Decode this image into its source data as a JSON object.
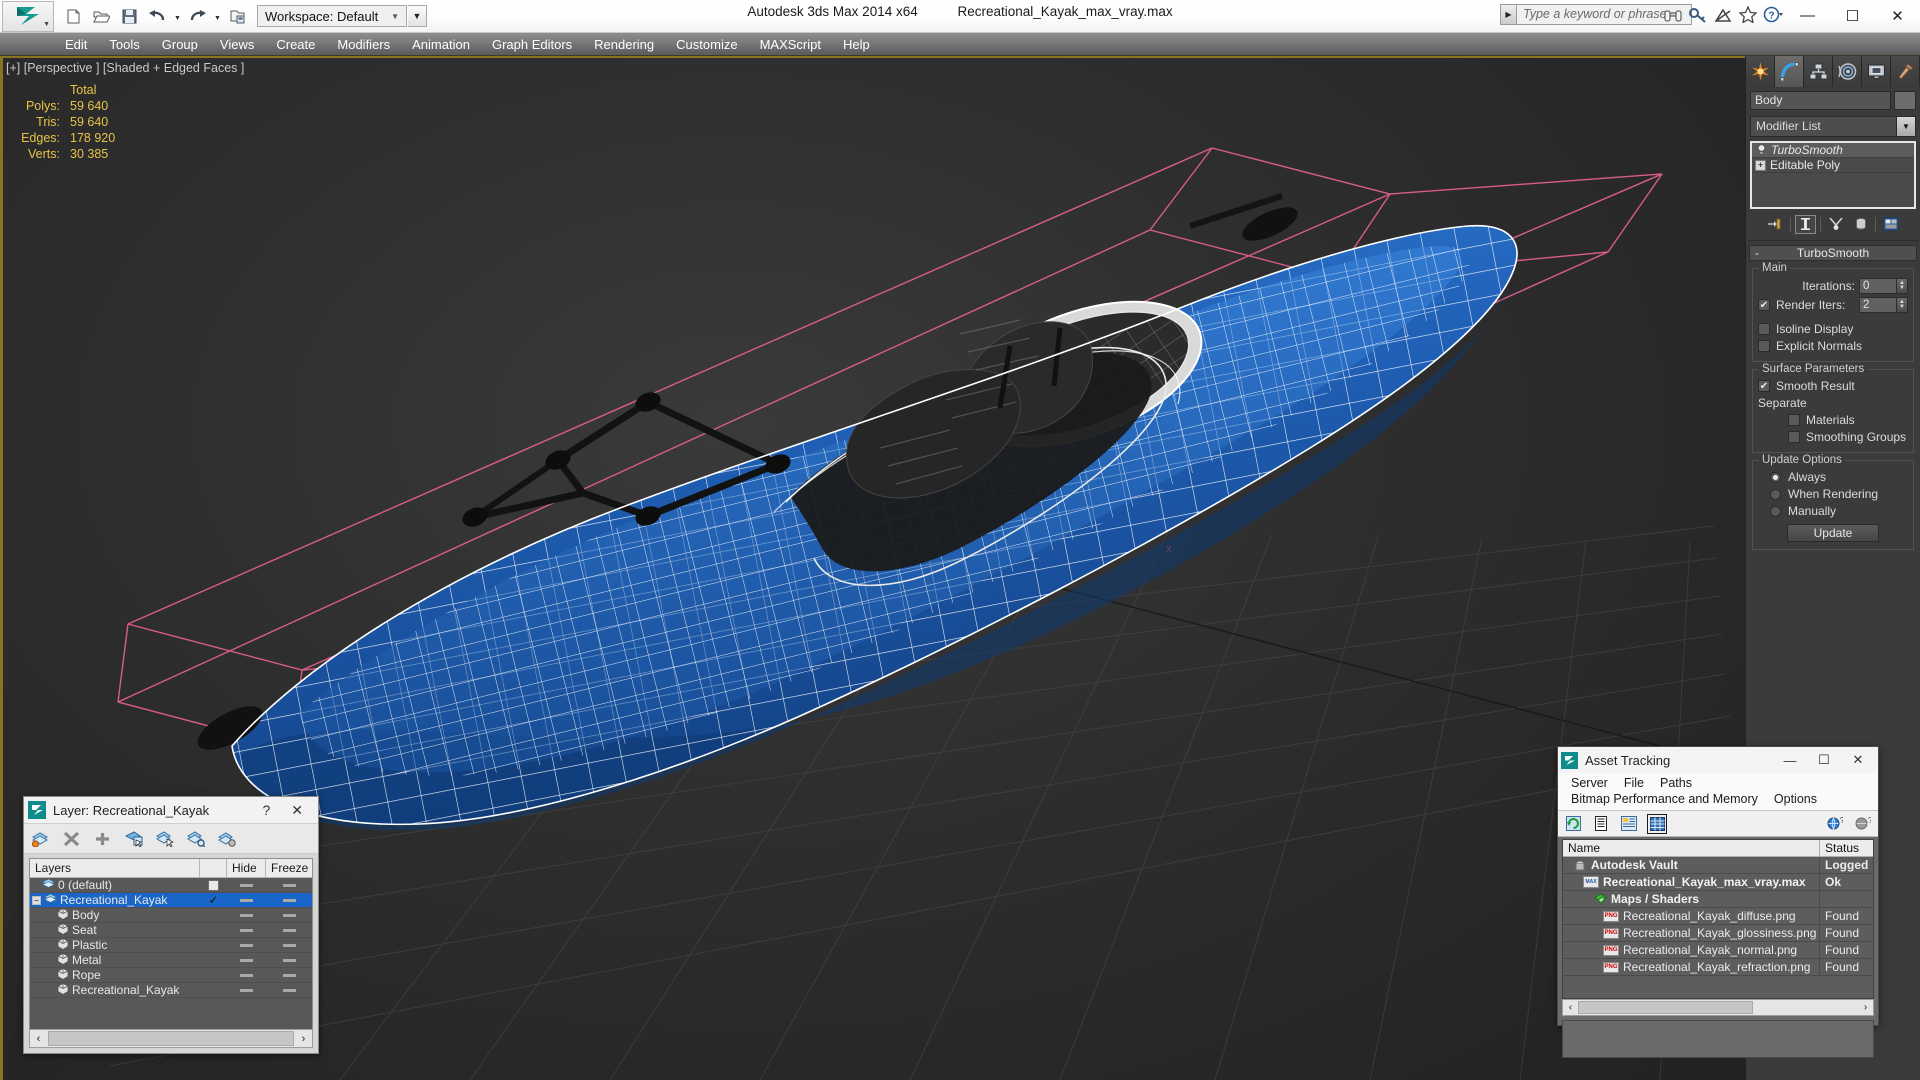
{
  "titlebar": {
    "app_logo_icon": "3dsmax-logo-icon",
    "quick_access": [
      {
        "name": "new-file-button",
        "icon": "new-file-icon"
      },
      {
        "name": "open-file-button",
        "icon": "open-folder-icon"
      },
      {
        "name": "save-file-button",
        "icon": "save-disk-icon"
      },
      {
        "name": "undo-button",
        "icon": "undo-arrow-icon"
      },
      {
        "name": "redo-button",
        "icon": "redo-arrow-icon"
      },
      {
        "name": "set-project-folder-button",
        "icon": "project-folder-icon"
      }
    ],
    "workspace_label": "Workspace: Default",
    "app_title": "Autodesk 3ds Max  2014 x64",
    "file_name": "Recreational_Kayak_max_vray.max",
    "search_placeholder": "Type a keyword or phrase",
    "infocenter_icons": [
      "binoculars-icon",
      "key-icon",
      "satellite-dish-icon",
      "star-favorites-icon",
      "help-question-icon"
    ],
    "window_controls": {
      "minimize": "—",
      "maximize": "☐",
      "close": "✕"
    }
  },
  "menubar": {
    "items": [
      "Edit",
      "Tools",
      "Group",
      "Views",
      "Create",
      "Modifiers",
      "Animation",
      "Graph Editors",
      "Rendering",
      "Customize",
      "MAXScript",
      "Help"
    ]
  },
  "viewport": {
    "label": "[+] [Perspective ] [Shaded + Edged Faces ]",
    "stats_header": "Total",
    "stats": [
      {
        "label": "Polys:",
        "value": "59 640"
      },
      {
        "label": "Tris:",
        "value": "59 640"
      },
      {
        "label": "Edges:",
        "value": "178 920"
      },
      {
        "label": "Verts:",
        "value": "30 385"
      }
    ],
    "model_colors": {
      "body": "#1f5fb5",
      "wire": "#ffffff",
      "accessory": "#1a1a1a",
      "gizmo_pink": "#e25f92",
      "grid": "#4a4a4a"
    }
  },
  "command_panel": {
    "tabs": [
      {
        "name": "create-tab",
        "icon": "star-burst-icon",
        "active": false
      },
      {
        "name": "modify-tab",
        "icon": "blue-arc-icon",
        "active": true
      },
      {
        "name": "hierarchy-tab",
        "icon": "hierarchy-tree-icon",
        "active": false
      },
      {
        "name": "motion-tab",
        "icon": "motion-wheel-icon",
        "active": false
      },
      {
        "name": "display-tab",
        "icon": "monitor-display-icon",
        "active": false
      },
      {
        "name": "utilities-tab",
        "icon": "hammer-icon",
        "active": false
      }
    ],
    "object_name": "Body",
    "modifier_list_label": "Modifier List",
    "stack": [
      {
        "label": "TurboSmooth",
        "selected": true,
        "icon": "lightbulb-icon"
      },
      {
        "label": "Editable Poly",
        "selected": false,
        "icon": "plus-box-icon"
      }
    ],
    "stack_tools": [
      "pin-stack-icon",
      "show-end-result-icon",
      "make-unique-icon",
      "remove-modifier-icon",
      "configure-sets-icon"
    ],
    "rollout": {
      "title": "TurboSmooth",
      "collapse_glyph": "-",
      "main_group": "Main",
      "iterations_label": "Iterations:",
      "iterations_value": "0",
      "render_iters_label": "Render Iters:",
      "render_iters_value": "2",
      "render_iters_checked": true,
      "isoline_display_label": "Isoline Display",
      "isoline_display_checked": false,
      "explicit_normals_label": "Explicit Normals",
      "explicit_normals_checked": false,
      "surface_group": "Surface Parameters",
      "smooth_result_label": "Smooth Result",
      "smooth_result_checked": true,
      "separate_label": "Separate",
      "materials_label": "Materials",
      "materials_checked": false,
      "smoothing_groups_label": "Smoothing Groups",
      "smoothing_groups_checked": false,
      "update_group": "Update Options",
      "update_options": [
        {
          "label": "Always",
          "selected": true
        },
        {
          "label": "When Rendering",
          "selected": false
        },
        {
          "label": "Manually",
          "selected": false
        }
      ],
      "update_button": "Update"
    }
  },
  "layer_dialog": {
    "title": "Layer: Recreational_Kayak",
    "help_glyph": "?",
    "close_glyph": "✕",
    "toolbar_icons": [
      "create-new-layer-icon",
      "delete-layer-icon",
      "add-layer-icon",
      "select-objects-in-layer-icon",
      "select-highlighted-layer-icon",
      "highlight-selected-objects-icon",
      "layer-properties-icon"
    ],
    "columns": [
      "Layers",
      "",
      "Hide",
      "Freeze"
    ],
    "rows": [
      {
        "name": "0 (default)",
        "indent": 0,
        "icon": "layer-stack-icon",
        "selected": false,
        "expander": false,
        "current": "checkbox-empty",
        "hide": "dash",
        "freeze": "dash"
      },
      {
        "name": "Recreational_Kayak",
        "indent": 0,
        "icon": "layer-stack-icon",
        "selected": true,
        "expander": true,
        "current": "check",
        "hide": "dash",
        "freeze": "dash"
      },
      {
        "name": "Body",
        "indent": 1,
        "icon": "object-box-icon",
        "selected": false,
        "expander": false,
        "current": "",
        "hide": "dash",
        "freeze": "dash"
      },
      {
        "name": "Seat",
        "indent": 1,
        "icon": "object-box-icon",
        "selected": false,
        "expander": false,
        "current": "",
        "hide": "dash",
        "freeze": "dash"
      },
      {
        "name": "Plastic",
        "indent": 1,
        "icon": "object-box-icon",
        "selected": false,
        "expander": false,
        "current": "",
        "hide": "dash",
        "freeze": "dash"
      },
      {
        "name": "Metal",
        "indent": 1,
        "icon": "object-box-icon",
        "selected": false,
        "expander": false,
        "current": "",
        "hide": "dash",
        "freeze": "dash"
      },
      {
        "name": "Rope",
        "indent": 1,
        "icon": "object-box-icon",
        "selected": false,
        "expander": false,
        "current": "",
        "hide": "dash",
        "freeze": "dash"
      },
      {
        "name": "Recreational_Kayak",
        "indent": 1,
        "icon": "object-box-icon",
        "selected": false,
        "expander": false,
        "current": "",
        "hide": "dash",
        "freeze": "dash"
      }
    ],
    "scroll_left_glyph": "‹",
    "scroll_right_glyph": "›"
  },
  "asset_dialog": {
    "title": "Asset Tracking",
    "window_controls": {
      "minimize": "—",
      "maximize": "☐",
      "close": "✕"
    },
    "menu": [
      "Server",
      "File",
      "Paths",
      "Bitmap Performance and Memory",
      "Options"
    ],
    "toolbar_icons": [
      "refresh-icon",
      "list-view-icon",
      "detail-view-icon",
      "grid-view-icon",
      "vault-login-icon",
      "vault-logout-icon"
    ],
    "columns": [
      "Name",
      "Status"
    ],
    "rows": [
      {
        "name": "Autodesk Vault",
        "status": "Logged",
        "indent": 0,
        "icon": "vault-icon",
        "bold": true
      },
      {
        "name": "Recreational_Kayak_max_vray.max",
        "status": "Ok",
        "indent": 1,
        "icon": "max-file-icon",
        "bold": true
      },
      {
        "name": "Maps / Shaders",
        "status": "",
        "indent": 2,
        "icon": "maps-shaders-icon",
        "bold": true
      },
      {
        "name": "Recreational_Kayak_diffuse.png",
        "status": "Found",
        "indent": 3,
        "icon": "png-file-icon",
        "bold": false
      },
      {
        "name": "Recreational_Kayak_glossiness.png",
        "status": "Found",
        "indent": 3,
        "icon": "png-file-icon",
        "bold": false
      },
      {
        "name": "Recreational_Kayak_normal.png",
        "status": "Found",
        "indent": 3,
        "icon": "png-file-icon",
        "bold": false
      },
      {
        "name": "Recreational_Kayak_refraction.png",
        "status": "Found",
        "indent": 3,
        "icon": "png-file-icon",
        "bold": false
      }
    ],
    "scroll_left_glyph": "‹",
    "scroll_right_glyph": "›"
  }
}
